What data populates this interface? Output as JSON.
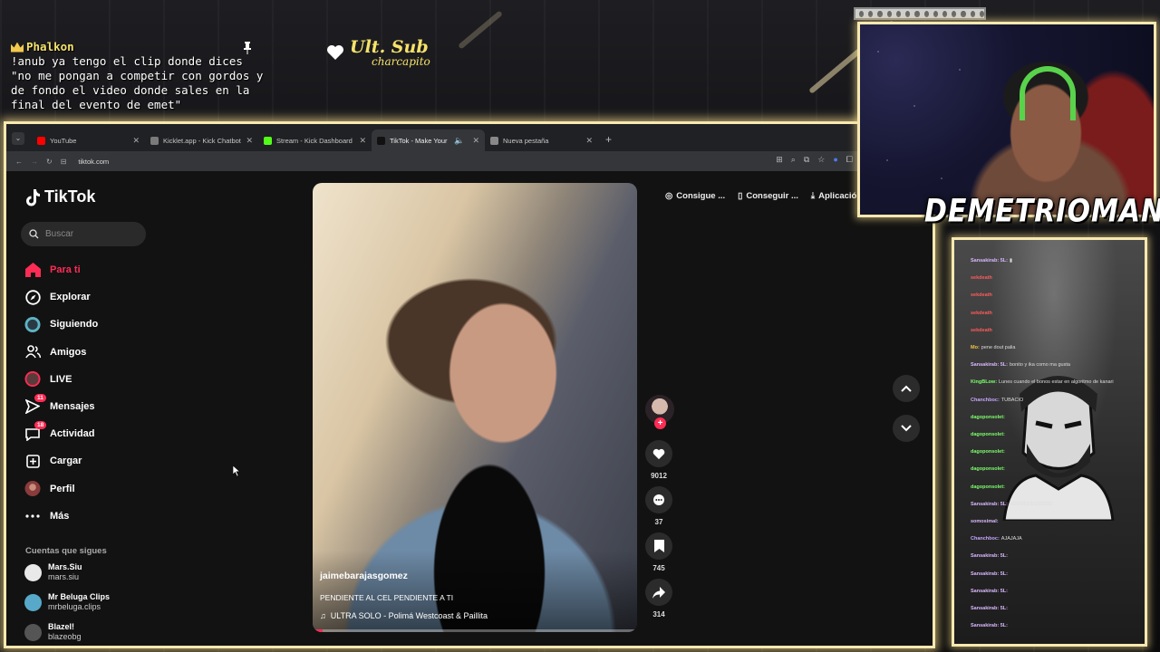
{
  "overlay": {
    "pinned_user": "Phalkon",
    "pinned_message": "!anub ya tengo el clip donde dices \"no me pongan a competir con gordos y de fondo el video donde sales en la final del evento de emet\"",
    "ult_sub_label": "Ult. Sub",
    "ult_sub_name": "charcapito",
    "streamer_name": "DEMETRIOMAN"
  },
  "browser": {
    "tabs": [
      {
        "label": "YouTube",
        "color": "#ff0000"
      },
      {
        "label": "Kicklet.app - Kick Chatbot and",
        "color": "#7a7a7a"
      },
      {
        "label": "Stream - Kick Dashboard",
        "color": "#53fc18"
      },
      {
        "label": "TikTok - Make Your Day",
        "color": "#111111",
        "active": true
      },
      {
        "label": "Nueva pestaña",
        "color": "#888888"
      }
    ],
    "url": "tiktok.com"
  },
  "tiktok": {
    "logo": "TikTok",
    "search_placeholder": "Buscar",
    "nav": [
      {
        "label": "Para ti",
        "icon": "home-icon",
        "active": true
      },
      {
        "label": "Explorar",
        "icon": "compass-icon"
      },
      {
        "label": "Siguiendo",
        "icon": "following-icon"
      },
      {
        "label": "Amigos",
        "icon": "friends-icon"
      },
      {
        "label": "LIVE",
        "icon": "live-icon"
      },
      {
        "label": "Mensajes",
        "icon": "messages-icon",
        "badge": "11"
      },
      {
        "label": "Actividad",
        "icon": "activity-icon",
        "badge": "18"
      },
      {
        "label": "Cargar",
        "icon": "upload-icon"
      },
      {
        "label": "Perfil",
        "icon": "profile-icon"
      },
      {
        "label": "Más",
        "icon": "more-icon"
      }
    ],
    "following_title": "Cuentas que sigues",
    "accounts": [
      {
        "name": "Mars.Siu",
        "handle": "mars.siu"
      },
      {
        "name": "Mr Beluga Clips",
        "handle": "mrbeluga.clips"
      },
      {
        "name": "Blazel!",
        "handle": "blazeobg"
      }
    ],
    "get_app": [
      "Consigue ...",
      "Conseguir ...",
      "Aplicación"
    ],
    "video": {
      "username": "jaimebarajasgomez",
      "description": "PENDIENTE AL CEL PENDIENTE A TI",
      "music": "ULTRA SOLO - Polimá Westcoast & Paillita",
      "progress": 0.03
    },
    "actions": {
      "likes": "9012",
      "comments": "37",
      "saves": "745",
      "shares": "314"
    }
  },
  "chat_lines": [
    {
      "user": "Sansakirab: 5L:",
      "msg": "▮",
      "color": "#d9b8ff"
    },
    {
      "user": "sekdeath",
      "msg": "",
      "color": "#ff5b5b"
    },
    {
      "user": "sekdeath",
      "msg": "",
      "color": "#ff5b5b"
    },
    {
      "user": "sekdeath",
      "msg": "",
      "color": "#ff5b5b"
    },
    {
      "user": "sekdeath",
      "msg": "",
      "color": "#ff5b5b"
    },
    {
      "user": "Mo:",
      "msg": "pene dout palia",
      "color": "#f5c542"
    },
    {
      "user": "Sansakirab: 5L:",
      "msg": "bonito y ika como ma gusta",
      "color": "#d9b8ff"
    },
    {
      "user": "KingBLow:",
      "msg": "Lunes cuando el bonos estar en algoritmo de kanari",
      "color": "#7cff6b"
    },
    {
      "user": "Chanchboc:",
      "msg": "TUBACIO",
      "color": "#c7a6ff"
    },
    {
      "user": "dagoponsolet:",
      "msg": "",
      "color": "#7cff6b"
    },
    {
      "user": "dagoponsolet:",
      "msg": "",
      "color": "#7cff6b"
    },
    {
      "user": "dagoponsolet:",
      "msg": "",
      "color": "#7cff6b"
    },
    {
      "user": "dagoponsolet:",
      "msg": "",
      "color": "#7cff6b"
    },
    {
      "user": "dagoponsolet:",
      "msg": "",
      "color": "#7cff6b"
    },
    {
      "user": "Sansakirab: 5L:",
      "msg": "XDDDDDDDDDDD",
      "color": "#d9b8ff"
    },
    {
      "user": "somosimal:",
      "msg": "",
      "color": "#d9b8ff"
    },
    {
      "user": "Chanchboc:",
      "msg": "AJAJAJA",
      "color": "#c7a6ff"
    },
    {
      "user": "Sansakirab: 5L:",
      "msg": "",
      "color": "#d9b8ff"
    },
    {
      "user": "Sansakirab: 5L:",
      "msg": "",
      "color": "#d9b8ff"
    },
    {
      "user": "Sansakirab: 5L:",
      "msg": "",
      "color": "#d9b8ff"
    },
    {
      "user": "Sansakirab: 5L:",
      "msg": "",
      "color": "#d9b8ff"
    },
    {
      "user": "Sansakirab: 5L:",
      "msg": "",
      "color": "#d9b8ff"
    }
  ],
  "colors": {
    "accent": "#fe2c55",
    "frame": "#f7e8b0",
    "overlay_text": "#f5e26a"
  }
}
